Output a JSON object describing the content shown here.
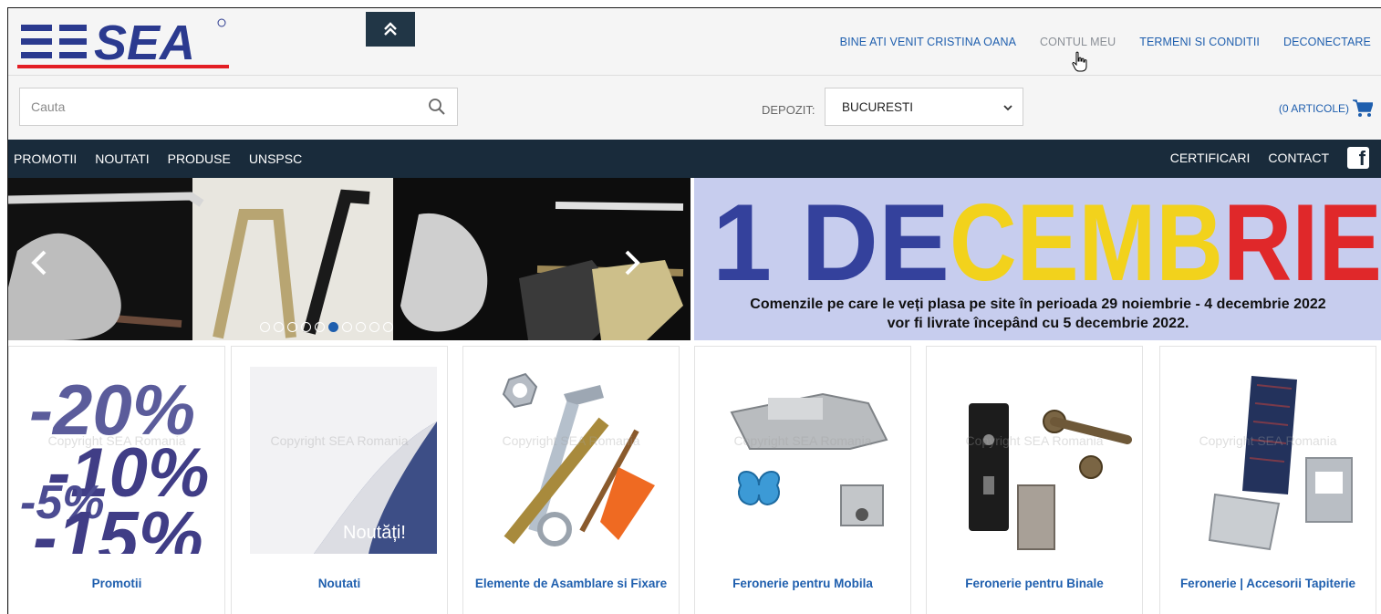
{
  "header": {
    "brand": "SEA",
    "links": [
      {
        "label": "BINE ATI VENIT CRISTINA OANA",
        "muted": false
      },
      {
        "label": "CONTUL MEU",
        "muted": true
      },
      {
        "label": "TERMENI SI CONDITII",
        "muted": false
      },
      {
        "label": "DECONECTARE",
        "muted": false
      }
    ]
  },
  "search": {
    "placeholder": "Cauta"
  },
  "depot": {
    "label": "DEPOZIT:",
    "selected": "BUCURESTI"
  },
  "cart": {
    "label": "(0 ARTICOLE)"
  },
  "nav": {
    "left": [
      "PROMOTII",
      "NOUTATI",
      "PRODUSE",
      "UNSPSC"
    ],
    "right": [
      "CERTIFICARI",
      "CONTACT"
    ]
  },
  "banner": {
    "headline_1": "1 DE",
    "headline_2": "CEMB",
    "headline_3": "RIE",
    "line1": "Comenzile pe care le veți plasa pe site în perioada 29 noiembrie - 4 decembrie 2022",
    "line2": "vor fi livrate începând cu 5 decembrie 2022."
  },
  "slider": {
    "dot_count": 10,
    "active_index": 5
  },
  "products": [
    {
      "title": "Promotii"
    },
    {
      "title": "Noutati"
    },
    {
      "title": "Elemente de Asamblare si Fixare"
    },
    {
      "title": "Feronerie pentru Mobila"
    },
    {
      "title": "Feronerie pentru Binale"
    },
    {
      "title": "Feronerie | Accesorii Tapiterie"
    }
  ],
  "promo_image_text": [
    "-20%",
    "-10%",
    "-5%",
    "-15%"
  ],
  "noutati_image_text": "Noutăți!",
  "watermark": "Copyright SEA Romania",
  "colors": {
    "brand_blue": "#1f5fae",
    "nav_bg": "#192b3b",
    "logo_red": "#e31e24"
  }
}
